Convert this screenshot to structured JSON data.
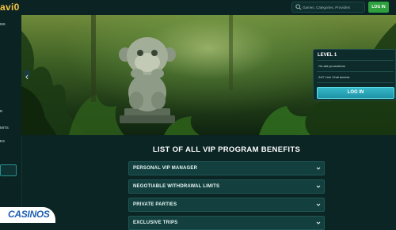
{
  "header": {
    "logo_text": "avi0",
    "search_placeholder": "Games, Categories, Providers",
    "login_label": "LOG IN"
  },
  "sidebar": {
    "items": [
      "MS",
      "",
      "",
      "",
      "",
      "",
      "D",
      "MITS",
      "ES"
    ]
  },
  "level_card": {
    "title": "LEVEL 1",
    "benefits": [
      "On-site promotions",
      "24/7 Live Chat access"
    ],
    "login_label": "LOG IN"
  },
  "benefits_section": {
    "title": "LIST OF ALL VIP PROGRAM BENEFITS",
    "items": [
      "PERSONAL VIP MANAGER",
      "NEGOTIABLE WITHDRAWAL LIMITS",
      "PRIVATE PARTIES",
      "EXCLUSIVE TRIPS"
    ]
  },
  "watermark": {
    "text": "CASINOS",
    "accent": "#1e5fb0"
  },
  "colors": {
    "background": "#0b2424",
    "accordion": "#13403f",
    "login_green": "#2ea03e",
    "login_cyan": "#35b9c9"
  },
  "icons": [
    "search-icon",
    "chevron-down-icon",
    "chevron-left-icon"
  ]
}
